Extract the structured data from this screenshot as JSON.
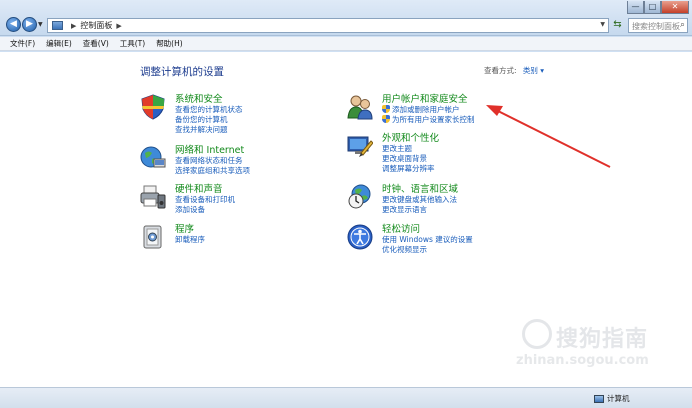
{
  "window": {
    "breadcrumb": "控制面板",
    "search_placeholder": "搜索控制面板",
    "min_label": "—",
    "max_label": "□",
    "close_label": "✕"
  },
  "menu": [
    "文件(F)",
    "编辑(E)",
    "查看(V)",
    "工具(T)",
    "帮助(H)"
  ],
  "content": {
    "title": "调整计算机的设置",
    "view_by_label": "查看方式:",
    "view_by_value": "类别 ▾"
  },
  "categories": [
    {
      "name": "系统和安全",
      "links": [
        "查看您的计算机状态",
        "备份您的计算机",
        "查找并解决问题"
      ]
    },
    {
      "name": "网络和 Internet",
      "links": [
        "查看网络状态和任务",
        "选择家庭组和共享选项"
      ]
    },
    {
      "name": "硬件和声音",
      "links": [
        "查看设备和打印机",
        "添加设备"
      ]
    },
    {
      "name": "程序",
      "links": [
        "卸载程序"
      ]
    },
    {
      "name": "用户帐户和家庭安全",
      "links": [
        "添加或删除用户帐户",
        "为所有用户设置家长控制"
      ]
    },
    {
      "name": "外观和个性化",
      "links": [
        "更改主题",
        "更改桌面背景",
        "调整屏幕分辨率"
      ]
    },
    {
      "name": "时钟、语言和区域",
      "links": [
        "更改键盘或其他输入法",
        "更改显示语言"
      ]
    },
    {
      "name": "轻松访问",
      "links": [
        "使用 Windows 建议的设置",
        "优化视频显示"
      ]
    }
  ],
  "watermark": {
    "text": "搜狗指南",
    "url": "zhinan.sogou.com"
  },
  "status": {
    "computer": "计算机"
  },
  "colors": {
    "heading": "#138a1c",
    "link": "#1a5dbb",
    "title": "#1e3d8f",
    "arrow": "#e0302a"
  }
}
